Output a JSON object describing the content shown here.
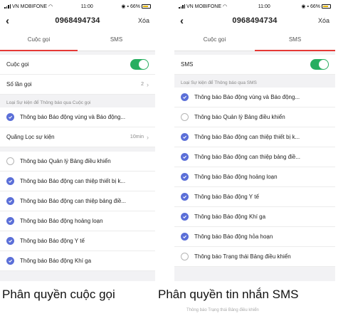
{
  "left": {
    "status": {
      "carrier": "VN MOBIFONE",
      "time": "11:00",
      "battery": "66%"
    },
    "nav": {
      "title": "0968494734",
      "delete_label": "Xóa"
    },
    "tabs": [
      {
        "label": "Cuộc gọi",
        "active": true
      },
      {
        "label": "SMS",
        "active": false
      }
    ],
    "call_toggle_label": "Cuộc gọi",
    "call_toggle_on": true,
    "call_count": {
      "label": "Số lần gọi",
      "value": "2"
    },
    "section_header": "Loại Sự kiện để Thông báo qua Cuộc gọi",
    "item_first": {
      "label": "Thông báo Báo động vùng và Báo động...",
      "checked": true
    },
    "interval": {
      "label": "Quãng Lọc sự kiện",
      "value": "10min"
    },
    "items": [
      {
        "label": "Thông báo Quản lý Bảng điều khiển",
        "checked": false
      },
      {
        "label": "Thông báo Báo động can thiệp thiết bị k...",
        "checked": true
      },
      {
        "label": "Thông báo Báo động can thiệp bảng điề...",
        "checked": true
      },
      {
        "label": "Thông báo Báo động hoảng loạn",
        "checked": true
      },
      {
        "label": "Thông báo Báo động Y tế",
        "checked": true
      },
      {
        "label": "Thông báo Báo động Khí ga",
        "checked": true
      }
    ]
  },
  "right": {
    "status": {
      "carrier": "VN MOBIFONE",
      "time": "11:00",
      "battery": "66%"
    },
    "nav": {
      "title": "0968494734",
      "delete_label": "Xóa"
    },
    "tabs": [
      {
        "label": "Cuộc gọi",
        "active": false
      },
      {
        "label": "SMS",
        "active": true
      }
    ],
    "sms_toggle_label": "SMS",
    "sms_toggle_on": true,
    "section_header": "Loại Sự kiện để Thông báo qua SMS",
    "items": [
      {
        "label": "Thông báo Báo động vùng và Báo động...",
        "checked": true
      },
      {
        "label": "Thông báo Quản lý Bảng điều khiển",
        "checked": false
      },
      {
        "label": "Thông báo Báo động can thiệp thiết bị k...",
        "checked": true
      },
      {
        "label": "Thông báo Báo động can thiệp bảng điề...",
        "checked": true
      },
      {
        "label": "Thông báo Báo động hoảng loạn",
        "checked": true
      },
      {
        "label": "Thông báo Báo động Y tế",
        "checked": true
      },
      {
        "label": "Thông báo Báo động Khí ga",
        "checked": true
      },
      {
        "label": "Thông báo Báo động hỏa hoạn",
        "checked": true
      },
      {
        "label": "Thông báo Trạng thái Bảng điều khiển",
        "checked": false
      }
    ]
  },
  "captions": {
    "left": "Phân quyền cuộc gọi",
    "right": "Phân quyền tin nhắn SMS",
    "ghost": "Thông báo Trạng thái Bảng điều khiển"
  },
  "colors": {
    "accent_tab": "#e53935",
    "toggle_on": "#27ae60",
    "check_on": "#5b6fd8"
  }
}
